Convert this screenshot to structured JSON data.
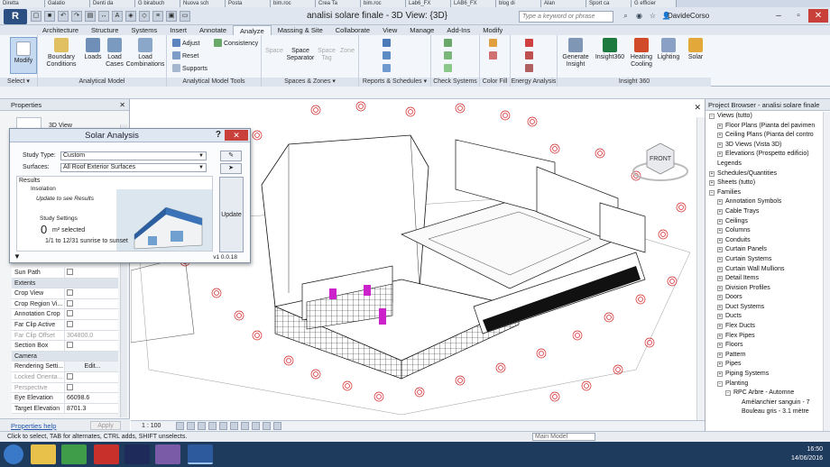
{
  "browser_tabs": [
    "Diretta",
    "Galatio",
    "Denti da",
    "G birabuch",
    "Nuova sch",
    "Posta",
    "bim.roc",
    "Crea Ta",
    "bim.roc",
    "Lab6_FX",
    "LAB6_FX",
    "blog di",
    "Alan",
    "Sport ca",
    "G efficier"
  ],
  "app": {
    "title": "analisi solare finale - 3D View: {3D}",
    "search_placeholder": "Type a keyword or phrase",
    "user": "DavideCorso"
  },
  "ribbon_tabs": [
    "Architecture",
    "Structure",
    "Systems",
    "Insert",
    "Annotate",
    "Analyze",
    "Massing & Site",
    "Collaborate",
    "View",
    "Manage",
    "Add-Ins",
    "Modify"
  ],
  "ribbon": {
    "modify": "Modify",
    "boundary_conditions": "Boundary Conditions",
    "loads": "Loads",
    "load_cases": "Load Cases",
    "load_combinations": "Load Combinations",
    "adjust": "Adjust",
    "reset": "Reset",
    "supports": "Supports",
    "consistency": "Consistency",
    "space": "Space",
    "space_separator": "Space Separator",
    "space_tag": "Space Tag",
    "zone": "Zone",
    "generate_insight": "Generate Insight",
    "insight360": "Insight360",
    "heating_cooling": "Heating Cooling",
    "lighting": "Lighting",
    "solar": "Solar",
    "groups": [
      "Select ▾",
      "Analytical Model",
      "Analytical Model Tools",
      "Spaces & Zones ▾",
      "Reports & Schedules ▾",
      "Check Systems",
      "Color Fill",
      "Energy Analysis",
      "Insight 360"
    ]
  },
  "properties": {
    "header": "Properties",
    "thumb_label": "3D View",
    "rows": [
      {
        "label": "Sun Path",
        "value": "",
        "type": "check"
      },
      {
        "label": "Extents",
        "value": "",
        "type": "section"
      },
      {
        "label": "Crop View",
        "value": "",
        "type": "check"
      },
      {
        "label": "Crop Region Vi...",
        "value": "",
        "type": "check"
      },
      {
        "label": "Annotation Crop",
        "value": "",
        "type": "check"
      },
      {
        "label": "Far Clip Active",
        "value": "",
        "type": "check"
      },
      {
        "label": "Far Clip Offset",
        "value": "304800.0",
        "type": "grey"
      },
      {
        "label": "Section Box",
        "value": "",
        "type": "check"
      },
      {
        "label": "Camera",
        "value": "",
        "type": "section"
      },
      {
        "label": "Rendering Setti...",
        "value": "Edit...",
        "type": "button"
      },
      {
        "label": "Locked Orienta...",
        "value": "",
        "type": "greycheck"
      },
      {
        "label": "Perspective",
        "value": "",
        "type": "greycheck"
      },
      {
        "label": "Eye Elevation",
        "value": "66098.6",
        "type": "text"
      },
      {
        "label": "Target Elevation",
        "value": "8701.3",
        "type": "text"
      }
    ],
    "help_link": "Properties help",
    "apply": "Apply"
  },
  "solar": {
    "title": "Solar Analysis",
    "study_type_label": "Study Type:",
    "study_type_value": "Custom",
    "surfaces_label": "Surfaces:",
    "surfaces_value": "All Roof Exterior Surfaces",
    "results_label": "Results",
    "insolation_label": "Insolation",
    "update_hint": "Update to see Results",
    "study_settings_label": "Study Settings",
    "selected_count": "0",
    "selected_unit": "m² selected",
    "period": "1/1 to 12/31 sunrise to sunset",
    "update_button": "Update",
    "version": "v1 0.0.18"
  },
  "view": {
    "viewcube_label": "FRONT",
    "scale": "1 : 100"
  },
  "project_browser": {
    "header": "Project Browser - analisi solare finale",
    "items": [
      {
        "label": "Views (tutto)",
        "level": 0,
        "tog": "−"
      },
      {
        "label": "Floor Plans (Pianta del pavimen",
        "level": 1,
        "tog": "+"
      },
      {
        "label": "Ceiling Plans (Pianta del contro",
        "level": 1,
        "tog": "+"
      },
      {
        "label": "3D Views (Vista 3D)",
        "level": 1,
        "tog": "+"
      },
      {
        "label": "Elevations (Prospetto edificio)",
        "level": 1,
        "tog": "+"
      },
      {
        "label": "Legends",
        "level": 0,
        "tog": ""
      },
      {
        "label": "Schedules/Quantities",
        "level": 0,
        "tog": "+"
      },
      {
        "label": "Sheets (tutto)",
        "level": 0,
        "tog": "+"
      },
      {
        "label": "Families",
        "level": 0,
        "tog": "−"
      },
      {
        "label": "Annotation Symbols",
        "level": 1,
        "tog": "+"
      },
      {
        "label": "Cable Trays",
        "level": 1,
        "tog": "+"
      },
      {
        "label": "Ceilings",
        "level": 1,
        "tog": "+"
      },
      {
        "label": "Columns",
        "level": 1,
        "tog": "+"
      },
      {
        "label": "Conduits",
        "level": 1,
        "tog": "+"
      },
      {
        "label": "Curtain Panels",
        "level": 1,
        "tog": "+"
      },
      {
        "label": "Curtain Systems",
        "level": 1,
        "tog": "+"
      },
      {
        "label": "Curtain Wall Mullions",
        "level": 1,
        "tog": "+"
      },
      {
        "label": "Detail Items",
        "level": 1,
        "tog": "+"
      },
      {
        "label": "Division Profiles",
        "level": 1,
        "tog": "+"
      },
      {
        "label": "Doors",
        "level": 1,
        "tog": "+"
      },
      {
        "label": "Duct Systems",
        "level": 1,
        "tog": "+"
      },
      {
        "label": "Ducts",
        "level": 1,
        "tog": "+"
      },
      {
        "label": "Flex Ducts",
        "level": 1,
        "tog": "+"
      },
      {
        "label": "Flex Pipes",
        "level": 1,
        "tog": "+"
      },
      {
        "label": "Floors",
        "level": 1,
        "tog": "+"
      },
      {
        "label": "Pattern",
        "level": 1,
        "tog": "+"
      },
      {
        "label": "Pipes",
        "level": 1,
        "tog": "+"
      },
      {
        "label": "Piping Systems",
        "level": 1,
        "tog": "+"
      },
      {
        "label": "Planting",
        "level": 1,
        "tog": "−"
      },
      {
        "label": "RPC Arbre - Automne",
        "level": 2,
        "tog": "−"
      },
      {
        "label": "Amélanchier sanguin - 7",
        "level": 3,
        "tog": ""
      },
      {
        "label": "Bouleau gris - 3.1 mètre",
        "level": 3,
        "tog": ""
      }
    ]
  },
  "status": {
    "message": "Click to select, TAB for alternates, CTRL adds, SHIFT unselects.",
    "model": "Main Model"
  },
  "taskbar": {
    "time": "16:50",
    "date": "14/06/2016"
  }
}
